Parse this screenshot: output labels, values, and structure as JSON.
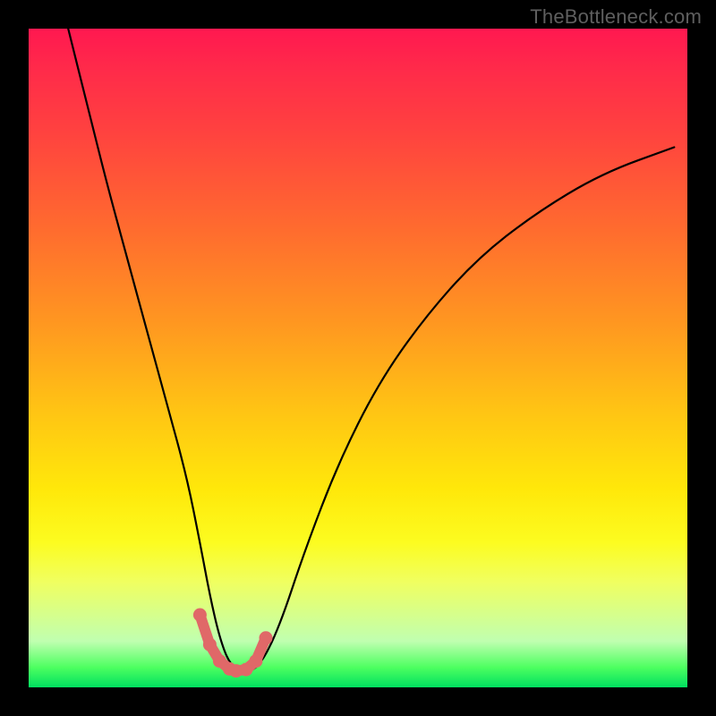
{
  "watermark": "TheBottleneck.com",
  "chart_data": {
    "type": "line",
    "title": "",
    "xlabel": "",
    "ylabel": "",
    "xlim": [
      0,
      100
    ],
    "ylim": [
      0,
      100
    ],
    "grid": false,
    "legend": false,
    "background_gradient": {
      "direction": "vertical",
      "stops": [
        {
          "pos": 0.0,
          "color": "#ff1850"
        },
        {
          "pos": 0.3,
          "color": "#ff6a2f"
        },
        {
          "pos": 0.58,
          "color": "#ffc414"
        },
        {
          "pos": 0.8,
          "color": "#f8ff40"
        },
        {
          "pos": 1.0,
          "color": "#00e060"
        }
      ]
    },
    "series": [
      {
        "name": "bottleneck-curve",
        "stroke": "#000000",
        "x": [
          6,
          9,
          12,
          15,
          18,
          21,
          24,
          26,
          27.5,
          29,
          30.5,
          32.5,
          35,
          38,
          42,
          47,
          53,
          60,
          68,
          77,
          87,
          98
        ],
        "y": [
          100,
          88,
          76,
          65,
          54,
          43,
          32,
          22,
          14,
          7.5,
          3.5,
          2.2,
          3.0,
          9,
          21,
          34,
          46,
          56,
          65,
          72,
          78,
          82
        ]
      },
      {
        "name": "highlight-band",
        "type": "scatter",
        "stroke": "#e06868",
        "fill": "#e06868",
        "x": [
          26,
          27.5,
          29,
          30.5,
          31.5,
          33,
          34.5,
          36
        ],
        "y": [
          11,
          6.5,
          4,
          2.8,
          2.5,
          2.7,
          4.0,
          7.5
        ]
      }
    ],
    "annotations": []
  }
}
